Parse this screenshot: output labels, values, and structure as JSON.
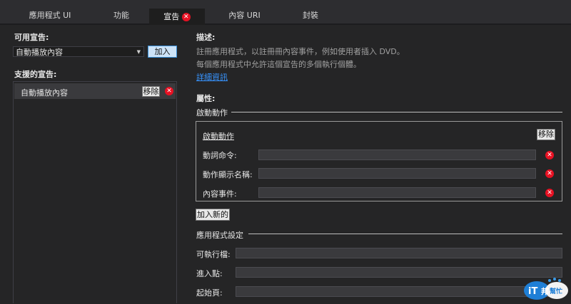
{
  "tabs": [
    {
      "label": "應用程式 UI"
    },
    {
      "label": "功能"
    },
    {
      "label": "宣告"
    },
    {
      "label": "內容 URI"
    },
    {
      "label": "封裝"
    }
  ],
  "left": {
    "available_label": "可用宣告:",
    "available_selected": "自動播放內容",
    "add_label": "加入",
    "supported_label": "支援的宣告:",
    "supported_items": [
      {
        "label": "自動播放內容",
        "remove_label": "移除"
      }
    ]
  },
  "right": {
    "description_label": "描述:",
    "description_line1": "註冊應用程式，以註冊冊內容事件，例如使用者插入 DVD。",
    "description_line2": "每個應用程式中允許這個宣告的多個執行個體。",
    "more_info_link": "詳細資訊",
    "properties_label": "屬性:",
    "launch_section": "啟動動作",
    "launch_panel_title": "啟動動作",
    "launch_remove": "移除",
    "launch_fields": [
      {
        "label": "動詞命令:",
        "value": ""
      },
      {
        "label": "動作顯示名稱:",
        "value": ""
      },
      {
        "label": "內容事件:",
        "value": ""
      }
    ],
    "add_new": "加入新的",
    "app_settings_section": "應用程式設定",
    "app_fields": [
      {
        "label": "可執行檔:",
        "value": ""
      },
      {
        "label": "進入點:",
        "value": ""
      },
      {
        "label": "起始頁:",
        "value": ""
      }
    ]
  },
  "watermark": {
    "text1": "iT",
    "text2": "邦",
    "text3": "幫忙"
  },
  "colors": {
    "accent": "#3794ff",
    "error": "#e81123",
    "background": "#252526"
  }
}
